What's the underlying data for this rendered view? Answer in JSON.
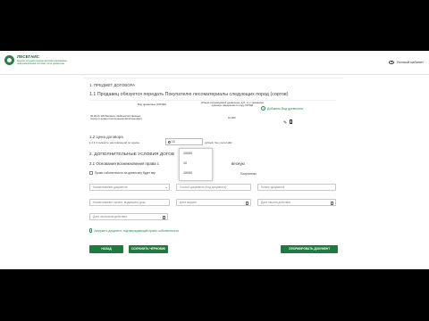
{
  "header": {
    "logo_title": "ЛЕСЕГАИС",
    "logo_subtitle": "Единая государственная автоматизированная информационная система учёта древесины",
    "user_label": "Личный кабинет"
  },
  "section1": {
    "title": "1. ПРЕДМЕТ ДОГОВОРА",
    "subtitle": "1.1 Продавец обязуется передать Покупателю лесоматериалы следующих пород (сортов)",
    "table": {
      "headers": [
        "Вид древесины (ОКПД2)",
        "Объем сопроводимой древесины, куб. м, с указанием единицы измерения по коду ОКПД2"
      ],
      "rows": [
        {
          "species": "02.20.11.120 Балансы хвойных/лиственных пород (с немногочисленными включениями)",
          "volume": "10,000"
        }
      ],
      "add_label": "Добавить Вид древесины"
    }
  },
  "price": {
    "title": "1.2 Цена договора",
    "label": "1.2.1 Стоимость заготовленной по сделке",
    "value": "10",
    "suffix": "рублей, без учета НДС",
    "options": [
      "10000",
      "10",
      "10000"
    ]
  },
  "section2": {
    "title": "2. ДОПОЛНИТЕЛЬНЫЕ УСЛОВИЯ ДОГОВ",
    "subtitle": "2.1 Основания возникновения права с",
    "subtitle_tail": "весную",
    "checkbox_label": "Право собственности на древесину будет пер",
    "checkbox_tail": "Покупателю"
  },
  "fields": {
    "row1": [
      "Наименование документа",
      "Способ документа (Код документа)",
      "Номер документа"
    ],
    "row2": [
      "Наименование органа, выдавшего доку",
      "Дата выдачи",
      "Дата начала действия"
    ],
    "row3": [
      "Дата окончания действия"
    ]
  },
  "attach_label": "Загрузить документ, подтверждающий право собственности",
  "buttons": {
    "back": "НАЗАД",
    "save_draft": "СОХРАНИТЬ ЧЕРНОВИК",
    "generate": "СФОРМИРОВАТЬ ДОКУМЕНТ"
  },
  "colors": {
    "brand_green": "#1f7a3f",
    "link_green": "#2e8b57",
    "letterbox": "#000000"
  }
}
